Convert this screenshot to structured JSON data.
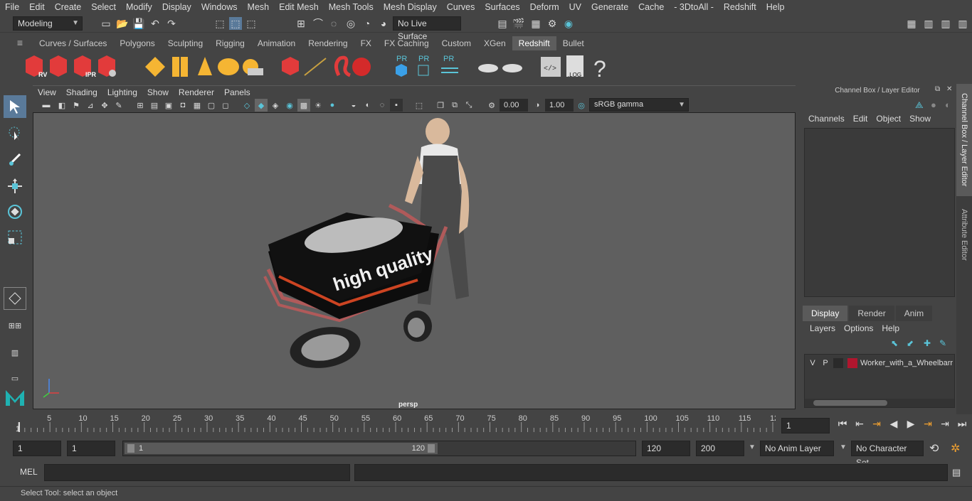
{
  "menubar": {
    "items": [
      "File",
      "Edit",
      "Create",
      "Select",
      "Modify",
      "Display",
      "Windows",
      "Mesh",
      "Edit Mesh",
      "Mesh Tools",
      "Mesh Display",
      "Curves",
      "Surfaces",
      "Deform",
      "UV",
      "Generate",
      "Cache",
      "- 3DtoAll -",
      "Redshift",
      "Help"
    ]
  },
  "status": {
    "mode": "Modeling",
    "live_surface": "No Live Surface"
  },
  "shelf": {
    "tabs": [
      "Curves / Surfaces",
      "Polygons",
      "Sculpting",
      "Rigging",
      "Animation",
      "Rendering",
      "FX",
      "FX Caching",
      "Custom",
      "XGen",
      "Redshift",
      "Bullet"
    ],
    "active": "Redshift",
    "labels": {
      "rv": "RV",
      "ipr": "IPR",
      "pr": "PR",
      "log": ".LOG",
      "help": "?"
    }
  },
  "viewport": {
    "menus": [
      "View",
      "Shading",
      "Lighting",
      "Show",
      "Renderer",
      "Panels"
    ],
    "exposure": "0.00",
    "gamma": "1.00",
    "colorspace": "sRGB gamma",
    "camera": "persp",
    "texture_text": "high quality"
  },
  "channelbox": {
    "title": "Channel Box / Layer Editor",
    "menus": [
      "Channels",
      "Edit",
      "Object",
      "Show"
    ],
    "tabs": [
      "Display",
      "Render",
      "Anim"
    ],
    "active_tab": "Display",
    "layer_menus": [
      "Layers",
      "Options",
      "Help"
    ],
    "layer": {
      "v": "V",
      "p": "P",
      "name": "Worker_with_a_Wheelbarrow",
      "color": "#b0162e"
    }
  },
  "sidetabs": [
    "Channel Box / Layer Editor",
    "Attribute Editor"
  ],
  "timeline": {
    "ticks": [
      "5",
      "10",
      "15",
      "20",
      "25",
      "30",
      "35",
      "40",
      "45",
      "50",
      "55",
      "60",
      "65",
      "70",
      "75",
      "80",
      "85",
      "90",
      "95",
      "100",
      "105",
      "110",
      "115",
      "12"
    ],
    "start": "1",
    "current_frame": "1"
  },
  "range": {
    "start": "1",
    "start2": "1",
    "slider_start": "1",
    "slider_end": "120",
    "end": "120",
    "total": "200",
    "anim_layer": "No Anim Layer",
    "char_set": "No Character Set"
  },
  "cmd": {
    "lang": "MEL"
  },
  "help": {
    "text": "Select Tool: select an object"
  },
  "colors": {
    "accent": "#5ac4d8",
    "redshift": "#e23b3b",
    "layer": "#b0162e"
  }
}
